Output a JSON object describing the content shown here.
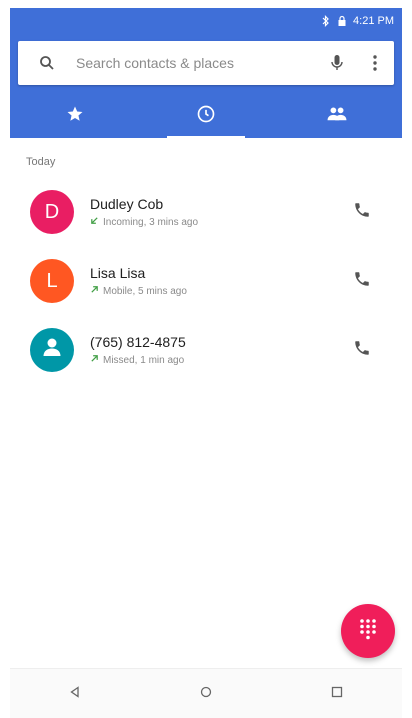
{
  "status_bar": {
    "time": "4:21 PM",
    "icons": [
      "bluetooth-icon",
      "lock-icon"
    ]
  },
  "search": {
    "placeholder": "Search contacts & places",
    "icons": [
      "search-icon",
      "mic-icon",
      "more-vert-icon"
    ]
  },
  "tabs": [
    {
      "name": "speed-dial",
      "icon": "star-icon"
    },
    {
      "name": "recents",
      "icon": "clock-icon",
      "active": true
    },
    {
      "name": "contacts",
      "icon": "people-icon"
    }
  ],
  "section": {
    "label": "Today"
  },
  "calls": [
    {
      "name": "Dudley Cob",
      "detail": "Incoming, 3 mins ago",
      "initial": "D",
      "avatar_color": "#e91e63"
    },
    {
      "name": "Lisa Lisa",
      "detail": "Mobile, 5 mins ago",
      "initial": "L",
      "avatar_color": "#ff5722"
    },
    {
      "name": "(765) 812-4875",
      "detail": "Missed, 1 min ago",
      "initial": "",
      "avatar_color": "#0097a7"
    }
  ],
  "fab": {
    "icon": "dialpad-icon",
    "color": "#f01e5a"
  },
  "nav": [
    "back-icon",
    "home-icon",
    "recents-icon"
  ],
  "colors": {
    "primary": "#3f6fd8",
    "accent": "#f01e5a"
  }
}
